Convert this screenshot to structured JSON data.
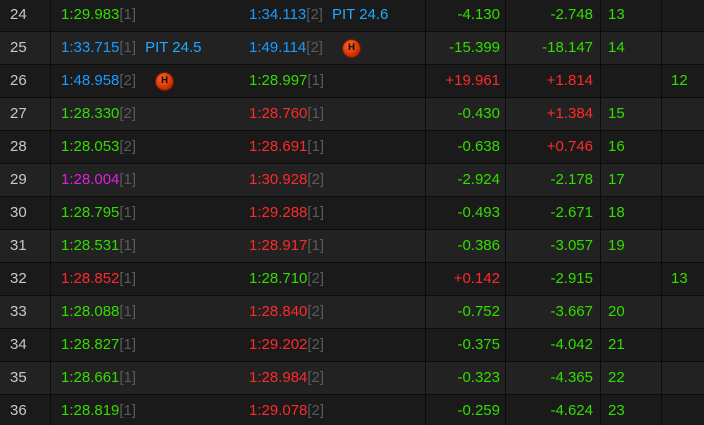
{
  "colors": {
    "green": "#33dd00",
    "red": "#ff2a2a",
    "blue": "#1a9cff",
    "purple": "#e21ee2",
    "tyre_gray": "#5a5a5a",
    "pit_blue": "#22aaff"
  },
  "rows": [
    {
      "lap": "24",
      "t1": "1:29.983",
      "t1_tyre": "[1]",
      "t1_color": "green",
      "t1_pit": "",
      "t1_badge": false,
      "t2": "1:34.113",
      "t2_tyre": "[2]",
      "t2_color": "blue",
      "t2_pit": "PIT 24.6",
      "t2_badge": false,
      "diff": "-4.130",
      "diff_color": "green",
      "cum": "-2.748",
      "cum_color": "green",
      "pos1": "13",
      "pos2": ""
    },
    {
      "lap": "25",
      "t1": "1:33.715",
      "t1_tyre": "[1]",
      "t1_color": "blue",
      "t1_pit": "PIT 24.5",
      "t1_badge": false,
      "t2": "1:49.114",
      "t2_tyre": "[2]",
      "t2_color": "blue",
      "t2_pit": "",
      "t2_badge": true,
      "badge_label": "H",
      "diff": "-15.399",
      "diff_color": "green",
      "cum": "-18.147",
      "cum_color": "green",
      "pos1": "14",
      "pos2": ""
    },
    {
      "lap": "26",
      "t1": "1:48.958",
      "t1_tyre": "[2]",
      "t1_color": "blue",
      "t1_pit": "",
      "t1_badge": true,
      "badge_label": "H",
      "t2": "1:28.997",
      "t2_tyre": "[1]",
      "t2_color": "green",
      "t2_pit": "",
      "t2_badge": false,
      "diff": "+19.961",
      "diff_color": "red",
      "cum": "+1.814",
      "cum_color": "red",
      "pos1": "",
      "pos2": "12"
    },
    {
      "lap": "27",
      "t1": "1:28.330",
      "t1_tyre": "[2]",
      "t1_color": "green",
      "t1_pit": "",
      "t1_badge": false,
      "t2": "1:28.760",
      "t2_tyre": "[1]",
      "t2_color": "red",
      "t2_pit": "",
      "t2_badge": false,
      "diff": "-0.430",
      "diff_color": "green",
      "cum": "+1.384",
      "cum_color": "red",
      "pos1": "15",
      "pos2": ""
    },
    {
      "lap": "28",
      "t1": "1:28.053",
      "t1_tyre": "[2]",
      "t1_color": "green",
      "t1_pit": "",
      "t1_badge": false,
      "t2": "1:28.691",
      "t2_tyre": "[1]",
      "t2_color": "red",
      "t2_pit": "",
      "t2_badge": false,
      "diff": "-0.638",
      "diff_color": "green",
      "cum": "+0.746",
      "cum_color": "red",
      "pos1": "16",
      "pos2": ""
    },
    {
      "lap": "29",
      "t1": "1:28.004",
      "t1_tyre": "[1]",
      "t1_color": "purple",
      "t1_pit": "",
      "t1_badge": false,
      "t2": "1:30.928",
      "t2_tyre": "[2]",
      "t2_color": "red",
      "t2_pit": "",
      "t2_badge": false,
      "diff": "-2.924",
      "diff_color": "green",
      "cum": "-2.178",
      "cum_color": "green",
      "pos1": "17",
      "pos2": ""
    },
    {
      "lap": "30",
      "t1": "1:28.795",
      "t1_tyre": "[1]",
      "t1_color": "green",
      "t1_pit": "",
      "t1_badge": false,
      "t2": "1:29.288",
      "t2_tyre": "[1]",
      "t2_color": "red",
      "t2_pit": "",
      "t2_badge": false,
      "diff": "-0.493",
      "diff_color": "green",
      "cum": "-2.671",
      "cum_color": "green",
      "pos1": "18",
      "pos2": ""
    },
    {
      "lap": "31",
      "t1": "1:28.531",
      "t1_tyre": "[1]",
      "t1_color": "green",
      "t1_pit": "",
      "t1_badge": false,
      "t2": "1:28.917",
      "t2_tyre": "[1]",
      "t2_color": "red",
      "t2_pit": "",
      "t2_badge": false,
      "diff": "-0.386",
      "diff_color": "green",
      "cum": "-3.057",
      "cum_color": "green",
      "pos1": "19",
      "pos2": ""
    },
    {
      "lap": "32",
      "t1": "1:28.852",
      "t1_tyre": "[1]",
      "t1_color": "red",
      "t1_pit": "",
      "t1_badge": false,
      "t2": "1:28.710",
      "t2_tyre": "[2]",
      "t2_color": "green",
      "t2_pit": "",
      "t2_badge": false,
      "diff": "+0.142",
      "diff_color": "red",
      "cum": "-2.915",
      "cum_color": "green",
      "pos1": "",
      "pos2": "13"
    },
    {
      "lap": "33",
      "t1": "1:28.088",
      "t1_tyre": "[1]",
      "t1_color": "green",
      "t1_pit": "",
      "t1_badge": false,
      "t2": "1:28.840",
      "t2_tyre": "[2]",
      "t2_color": "red",
      "t2_pit": "",
      "t2_badge": false,
      "diff": "-0.752",
      "diff_color": "green",
      "cum": "-3.667",
      "cum_color": "green",
      "pos1": "20",
      "pos2": ""
    },
    {
      "lap": "34",
      "t1": "1:28.827",
      "t1_tyre": "[1]",
      "t1_color": "green",
      "t1_pit": "",
      "t1_badge": false,
      "t2": "1:29.202",
      "t2_tyre": "[2]",
      "t2_color": "red",
      "t2_pit": "",
      "t2_badge": false,
      "diff": "-0.375",
      "diff_color": "green",
      "cum": "-4.042",
      "cum_color": "green",
      "pos1": "21",
      "pos2": ""
    },
    {
      "lap": "35",
      "t1": "1:28.661",
      "t1_tyre": "[1]",
      "t1_color": "green",
      "t1_pit": "",
      "t1_badge": false,
      "t2": "1:28.984",
      "t2_tyre": "[2]",
      "t2_color": "red",
      "t2_pit": "",
      "t2_badge": false,
      "diff": "-0.323",
      "diff_color": "green",
      "cum": "-4.365",
      "cum_color": "green",
      "pos1": "22",
      "pos2": ""
    },
    {
      "lap": "36",
      "t1": "1:28.819",
      "t1_tyre": "[1]",
      "t1_color": "green",
      "t1_pit": "",
      "t1_badge": false,
      "t2": "1:29.078",
      "t2_tyre": "[2]",
      "t2_color": "red",
      "t2_pit": "",
      "t2_badge": false,
      "diff": "-0.259",
      "diff_color": "green",
      "cum": "-4.624",
      "cum_color": "green",
      "pos1": "23",
      "pos2": ""
    }
  ]
}
